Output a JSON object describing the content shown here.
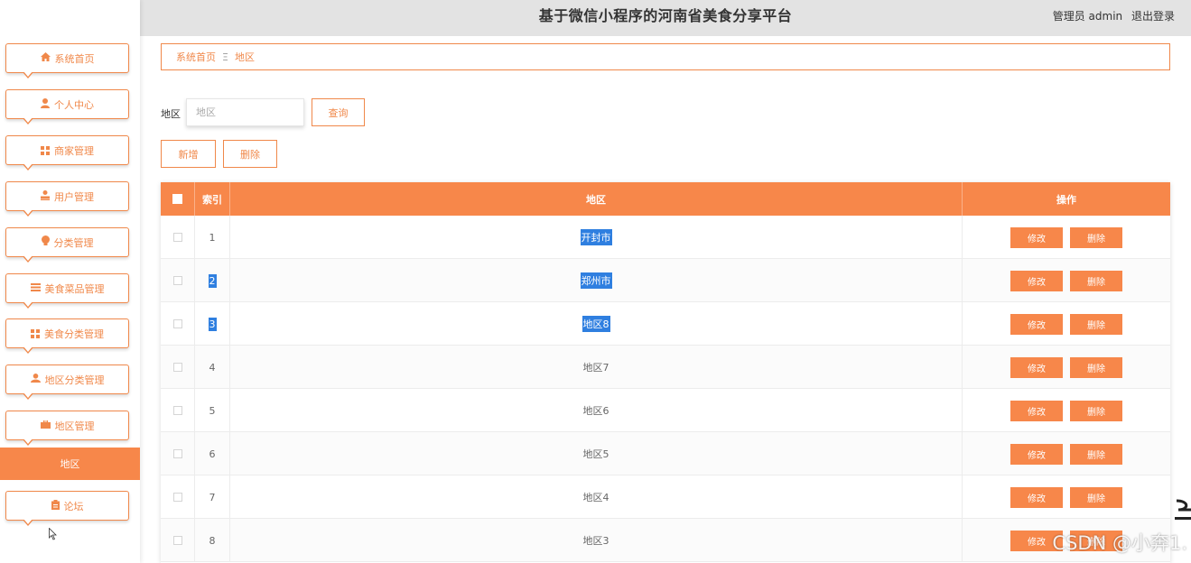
{
  "header": {
    "title": "基于微信小程序的河南省美食分享平台",
    "user_label": "管理员 admin",
    "logout_label": "退出登录"
  },
  "sidebar": {
    "items": [
      {
        "label": "系统首页",
        "icon": "home-icon"
      },
      {
        "label": "个人中心",
        "icon": "person-icon"
      },
      {
        "label": "商家管理",
        "icon": "grid-icon"
      },
      {
        "label": "用户管理",
        "icon": "user-icon"
      },
      {
        "label": "分类管理",
        "icon": "lightbulb-icon"
      },
      {
        "label": "美食菜品管理",
        "icon": "list-icon"
      },
      {
        "label": "美食分类管理",
        "icon": "grid-icon"
      },
      {
        "label": "地区分类管理",
        "icon": "users-icon"
      },
      {
        "label": "地区管理",
        "icon": "briefcase-icon"
      },
      {
        "label": "论坛",
        "icon": "clipboard-icon"
      }
    ],
    "active_sub": "地区"
  },
  "breadcrumb": {
    "home": "系统首页",
    "separator": "Ξ",
    "current": "地区"
  },
  "search": {
    "label": "地区",
    "placeholder": "地区",
    "button": "查询"
  },
  "actions": {
    "add": "新增",
    "delete": "删除"
  },
  "table": {
    "columns": {
      "index": "索引",
      "region": "地区",
      "ops": "操作"
    },
    "edit_label": "修改",
    "delete_label": "删除",
    "rows": [
      {
        "index": "1",
        "region": "开封市",
        "index_selected": false,
        "region_selected": true
      },
      {
        "index": "2",
        "region": "郑州市",
        "index_selected": true,
        "region_selected": true
      },
      {
        "index": "3",
        "region": "地区8",
        "index_selected": true,
        "region_selected": true
      },
      {
        "index": "4",
        "region": "地区7",
        "index_selected": false,
        "region_selected": false
      },
      {
        "index": "5",
        "region": "地区6",
        "index_selected": false,
        "region_selected": false
      },
      {
        "index": "6",
        "region": "地区5",
        "index_selected": false,
        "region_selected": false
      },
      {
        "index": "7",
        "region": "地区4",
        "index_selected": false,
        "region_selected": false
      },
      {
        "index": "8",
        "region": "地区3",
        "index_selected": false,
        "region_selected": false
      }
    ]
  },
  "watermark": "CSDN @小奔1.",
  "colors": {
    "accent": "#f7874a",
    "header_bg": "#e3e3e3",
    "selection": "#2f7fe0"
  }
}
